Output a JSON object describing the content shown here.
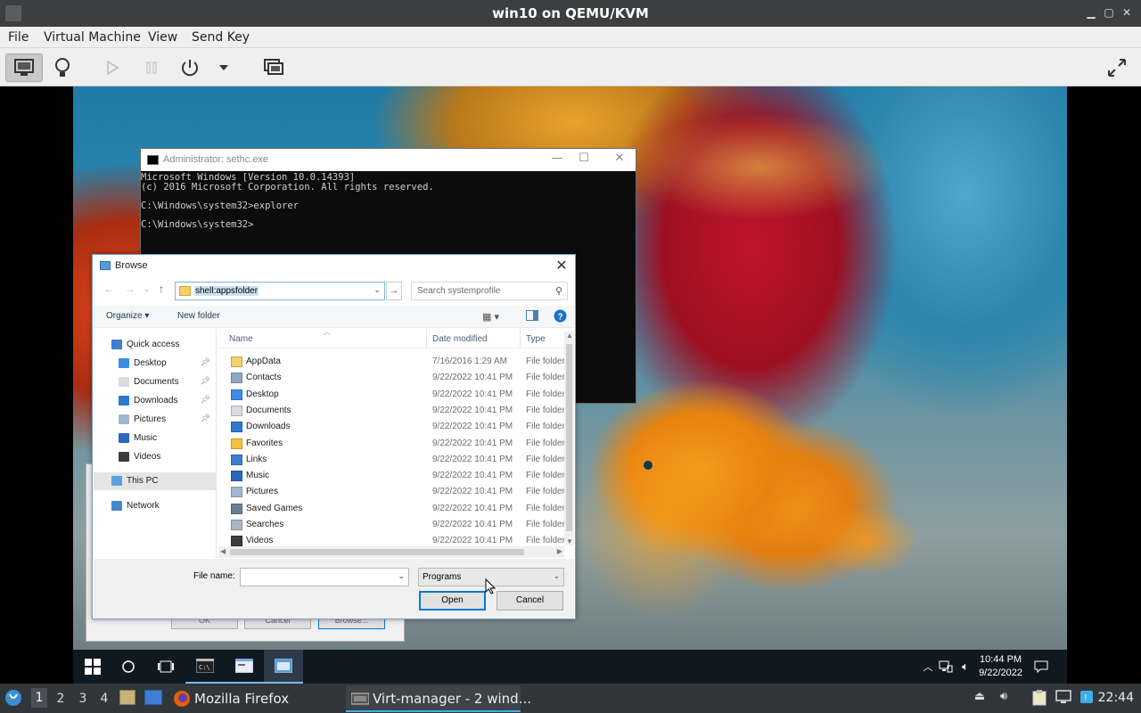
{
  "host_window": {
    "title": "win10 on QEMU/KVM",
    "menus": [
      "File",
      "Virtual Machine",
      "View",
      "Send Key"
    ]
  },
  "toolbar": {
    "buttons": [
      "console-view-icon",
      "details-view-icon",
      "run-icon",
      "pause-icon",
      "power-icon",
      "power-dropdown-icon",
      "snapshots-icon",
      "fullscreen-icon"
    ]
  },
  "cmd_window": {
    "title": "Administrator: sethc.exe",
    "lines": [
      "Microsoft Windows [Version 10.0.14393]",
      "(c) 2016 Microsoft Corporation. All rights reserved.",
      "",
      "C:\\Windows\\system32>explorer",
      "",
      "C:\\Windows\\system32>"
    ]
  },
  "run_dialog": {
    "buttons": [
      "OK",
      "Cancel",
      "Browse..."
    ]
  },
  "browse_dialog": {
    "title": "Browse",
    "address": "shell:appsfolder",
    "search_placeholder": "Search systemprofile",
    "organize_label": "Organize ▾",
    "new_folder_label": "New folder",
    "nav_items": [
      {
        "label": "Quick access",
        "icon": "star-icon",
        "pinned": false,
        "indent": 0
      },
      {
        "label": "Desktop",
        "icon": "desktop-icon",
        "pinned": true,
        "indent": 1
      },
      {
        "label": "Documents",
        "icon": "documents-icon",
        "pinned": true,
        "indent": 1
      },
      {
        "label": "Downloads",
        "icon": "downloads-icon",
        "pinned": true,
        "indent": 1
      },
      {
        "label": "Pictures",
        "icon": "pictures-icon",
        "pinned": true,
        "indent": 1
      },
      {
        "label": "Music",
        "icon": "music-icon",
        "pinned": false,
        "indent": 1
      },
      {
        "label": "Videos",
        "icon": "videos-icon",
        "pinned": false,
        "indent": 1
      },
      {
        "label": "This PC",
        "icon": "computer-icon",
        "pinned": false,
        "indent": 0,
        "selected": true
      },
      {
        "label": "Network",
        "icon": "network-icon",
        "pinned": false,
        "indent": 0
      }
    ],
    "columns": [
      "Name",
      "Date modified",
      "Type"
    ],
    "files": [
      {
        "name": "AppData",
        "date": "7/16/2016 1:29 AM",
        "type": "File folder",
        "icon": "folder-icon"
      },
      {
        "name": "Contacts",
        "date": "9/22/2022 10:41 PM",
        "type": "File folder",
        "icon": "contacts-icon"
      },
      {
        "name": "Desktop",
        "date": "9/22/2022 10:41 PM",
        "type": "File folder",
        "icon": "desktop-icon"
      },
      {
        "name": "Documents",
        "date": "9/22/2022 10:41 PM",
        "type": "File folder",
        "icon": "documents-icon"
      },
      {
        "name": "Downloads",
        "date": "9/22/2022 10:41 PM",
        "type": "File folder",
        "icon": "downloads-icon"
      },
      {
        "name": "Favorites",
        "date": "9/22/2022 10:41 PM",
        "type": "File folder",
        "icon": "favorites-icon"
      },
      {
        "name": "Links",
        "date": "9/22/2022 10:41 PM",
        "type": "File folder",
        "icon": "links-icon"
      },
      {
        "name": "Music",
        "date": "9/22/2022 10:41 PM",
        "type": "File folder",
        "icon": "music-icon"
      },
      {
        "name": "Pictures",
        "date": "9/22/2022 10:41 PM",
        "type": "File folder",
        "icon": "pictures-icon"
      },
      {
        "name": "Saved Games",
        "date": "9/22/2022 10:41 PM",
        "type": "File folder",
        "icon": "saved-games-icon"
      },
      {
        "name": "Searches",
        "date": "9/22/2022 10:41 PM",
        "type": "File folder",
        "icon": "searches-icon"
      },
      {
        "name": "Videos",
        "date": "9/22/2022 10:41 PM",
        "type": "File folder",
        "icon": "videos-icon"
      }
    ],
    "file_name_label": "File name:",
    "file_name_value": "",
    "file_type": "Programs",
    "open_label": "Open",
    "cancel_label": "Cancel"
  },
  "win_taskbar": {
    "time": "10:44 PM",
    "date": "9/22/2022"
  },
  "host_panel": {
    "workspaces": [
      "1",
      "2",
      "3",
      "4"
    ],
    "current_workspace": "1",
    "tasks": [
      {
        "label": "Mozilla Firefox",
        "active": false
      },
      {
        "label": "Virt-manager - 2 wind...",
        "active": true
      }
    ],
    "clock": "22:44"
  }
}
